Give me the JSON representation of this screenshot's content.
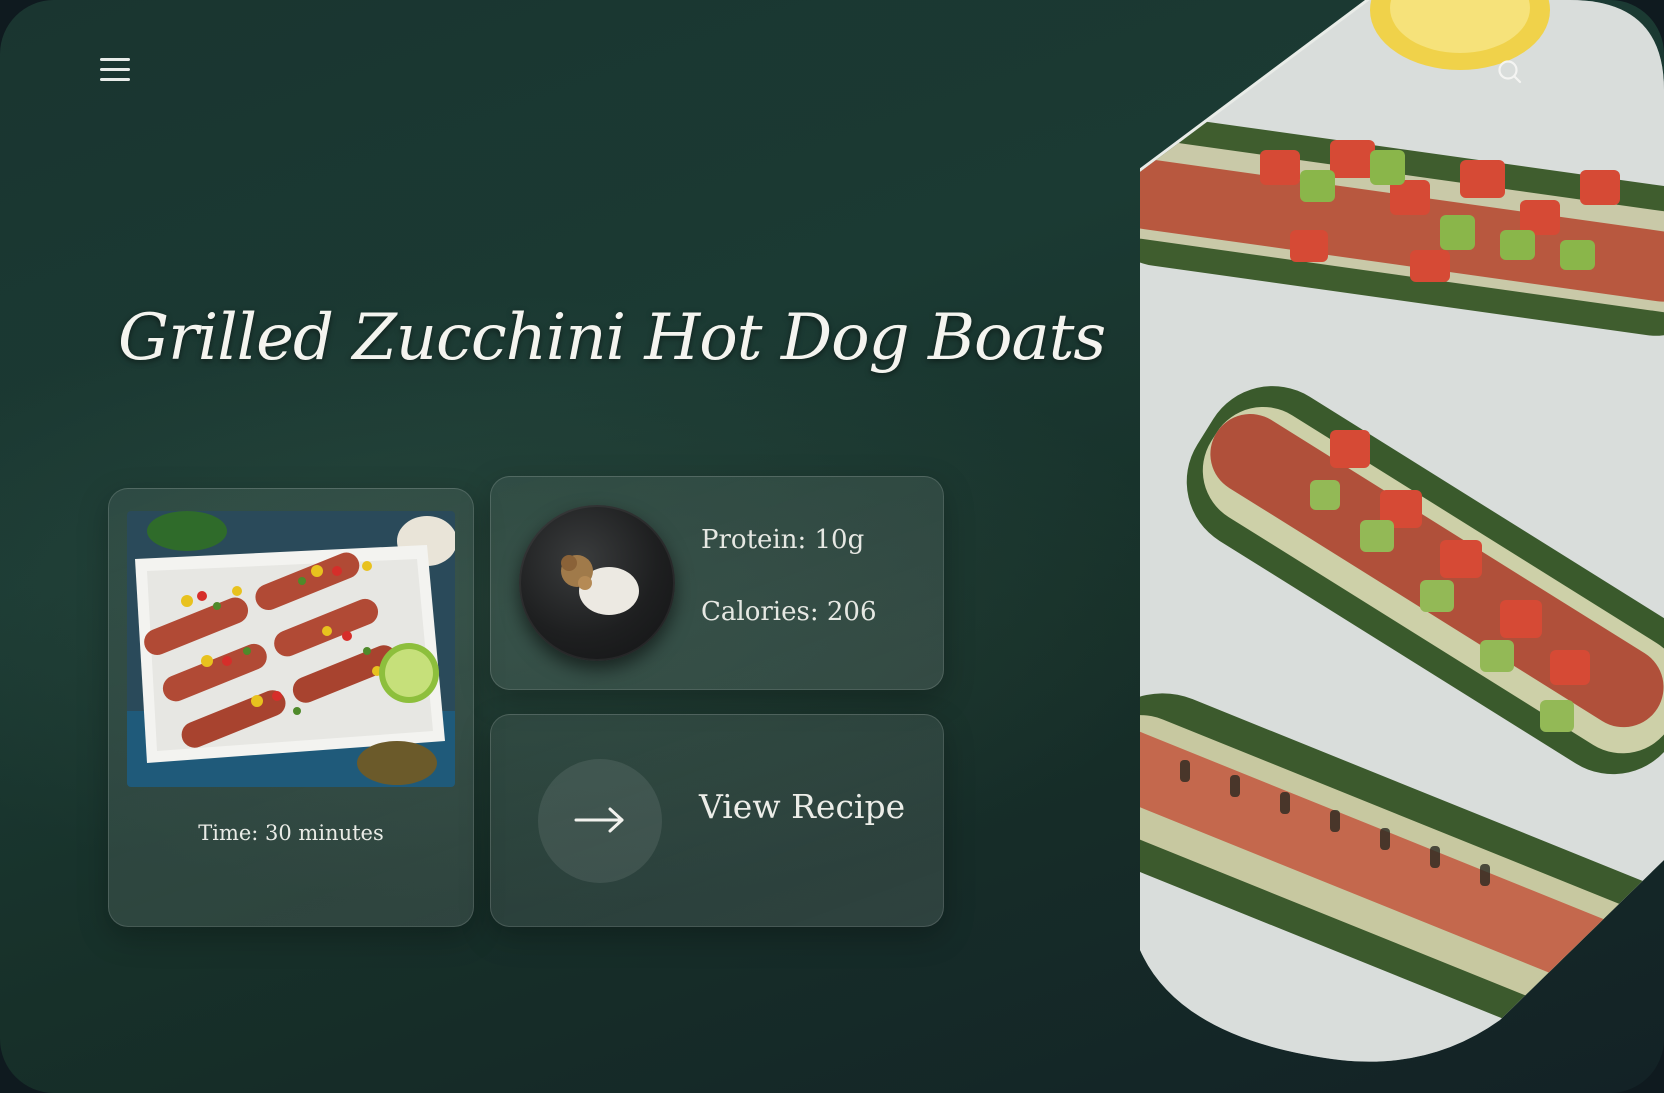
{
  "header": {
    "menu_icon": "hamburger-menu-icon",
    "search_icon": "search-icon"
  },
  "recipe": {
    "title": "Grilled Zucchini Hot Dog Boats",
    "time_label": "Time: 30 minutes",
    "protein_label": "Protein: 10g",
    "calories_label": "Calories: 206",
    "view_recipe_label": "View Recipe"
  },
  "colors": {
    "background": "#1b3a33",
    "text": "#f4f4ef",
    "card_border": "rgba(255,255,255,0.14)"
  }
}
